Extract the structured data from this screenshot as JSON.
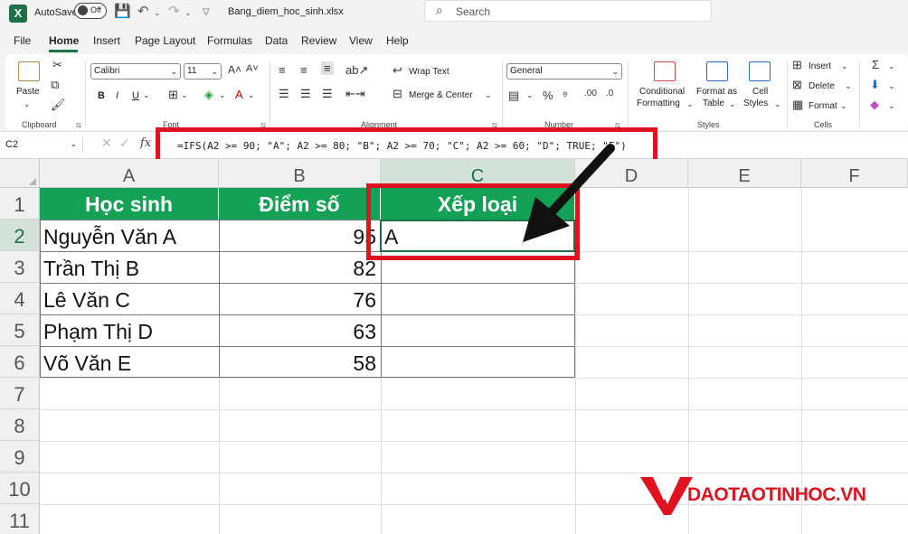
{
  "titlebar": {
    "autosave_label": "AutoSave",
    "autosave_state": "Off",
    "filename": "Bang_diem_hoc_sinh.xlsx",
    "search_placeholder": "Search"
  },
  "menu": {
    "tabs": [
      "File",
      "Home",
      "Insert",
      "Page Layout",
      "Formulas",
      "Data",
      "Review",
      "View",
      "Help"
    ],
    "active": "Home"
  },
  "ribbon": {
    "clipboard": {
      "paste": "Paste",
      "label": "Clipboard"
    },
    "font": {
      "name": "Calibri",
      "size": "11",
      "label": "Font",
      "bold": "B",
      "italic": "I",
      "underline": "U"
    },
    "alignment": {
      "wrap_text": "Wrap Text",
      "merge_center": "Merge & Center",
      "label": "Alignment"
    },
    "number": {
      "format": "General",
      "label": "Number"
    },
    "styles": {
      "conditional_formatting": [
        "Conditional",
        "Formatting"
      ],
      "format_as_table": [
        "Format as",
        "Table"
      ],
      "cell_styles": [
        "Cell",
        "Styles"
      ],
      "label": "Styles"
    },
    "cells": {
      "insert": "Insert",
      "delete": "Delete",
      "format": "Format",
      "label": "Cells"
    }
  },
  "formula_bar": {
    "name_box": "C2",
    "fx": "fx",
    "formula": "=IFS(A2 >= 90; \"A\"; A2 >= 80; \"B\"; A2 >= 70; \"C\"; A2 >= 60; \"D\"; TRUE; \"F\")"
  },
  "grid": {
    "columns": [
      "A",
      "B",
      "C",
      "D",
      "E",
      "F"
    ],
    "rows": [
      "1",
      "2",
      "3",
      "4",
      "5",
      "6",
      "7",
      "8",
      "9",
      "10",
      "11"
    ],
    "headers": [
      "Học sinh",
      "Điểm số",
      "Xếp loại"
    ],
    "data": [
      {
        "name": "Nguyễn Văn A",
        "score": "95",
        "grade": "A"
      },
      {
        "name": "Trần Thị B",
        "score": "82",
        "grade": ""
      },
      {
        "name": "Lê Văn C",
        "score": "76",
        "grade": ""
      },
      {
        "name": "Phạm Thị D",
        "score": "63",
        "grade": ""
      },
      {
        "name": "Võ Văn E",
        "score": "58",
        "grade": ""
      }
    ],
    "active_cell": "C2"
  },
  "annotation_colors": {
    "highlight": "#e0121f",
    "header_fill": "#12a155",
    "excel_green": "#1e7145"
  },
  "watermark": {
    "text": "DAOTAOTINHOC.VN"
  }
}
